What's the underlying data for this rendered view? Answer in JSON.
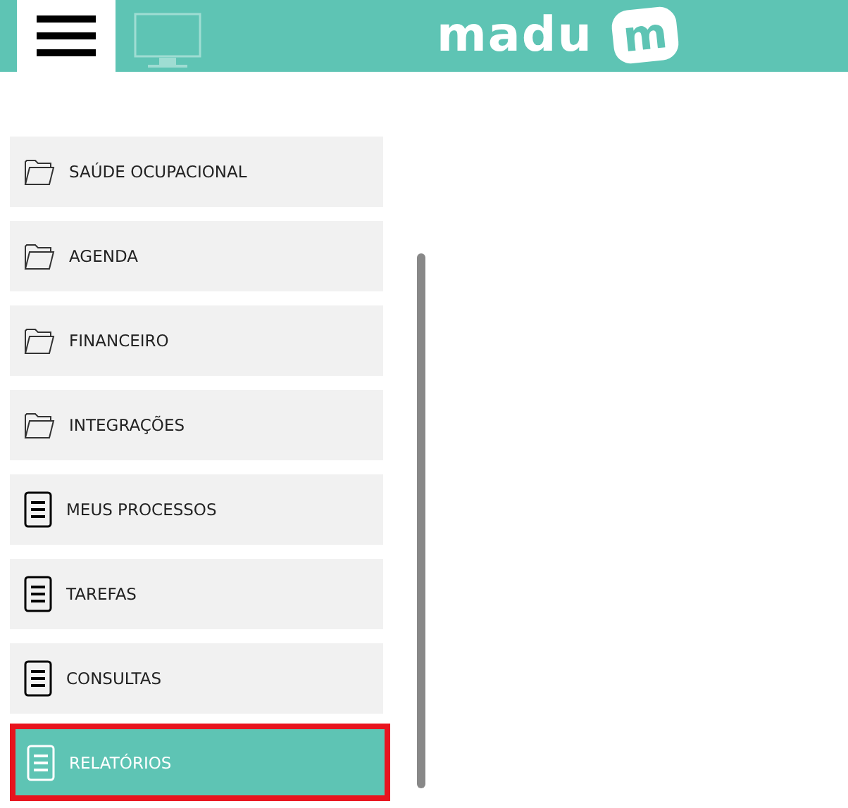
{
  "header": {
    "logo_text": "madu",
    "logo_badge": "m"
  },
  "menu": [
    {
      "label": "SAÚDE OCUPACIONAL",
      "kind": "folder",
      "selected": false
    },
    {
      "label": "AGENDA",
      "kind": "folder",
      "selected": false
    },
    {
      "label": "FINANCEIRO",
      "kind": "folder",
      "selected": false
    },
    {
      "label": "INTEGRAÇÕES",
      "kind": "folder",
      "selected": false
    },
    {
      "label": "MEUS PROCESSOS",
      "kind": "document",
      "selected": false
    },
    {
      "label": "TAREFAS",
      "kind": "document",
      "selected": false
    },
    {
      "label": "CONSULTAS",
      "kind": "document",
      "selected": false
    },
    {
      "label": "RELATÓRIOS",
      "kind": "document",
      "selected": true
    }
  ]
}
